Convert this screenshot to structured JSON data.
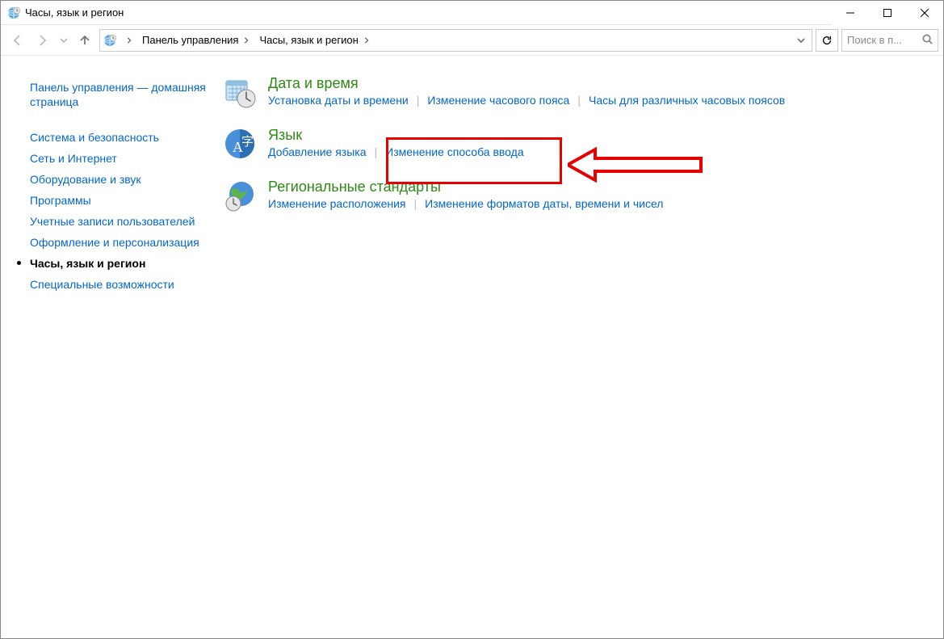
{
  "window": {
    "title": "Часы, язык и регион"
  },
  "breadcrumbs": {
    "root": "Панель управления",
    "current": "Часы, язык и регион"
  },
  "search": {
    "placeholder": "Поиск в п..."
  },
  "sidebar": {
    "home": "Панель управления — домашняя страница",
    "items": [
      "Система и безопасность",
      "Сеть и Интернет",
      "Оборудование и звук",
      "Программы",
      "Учетные записи пользователей",
      "Оформление и персонализация",
      "Часы, язык и регион",
      "Специальные возможности"
    ],
    "current_index": 6
  },
  "categories": [
    {
      "title": "Дата и время",
      "links": [
        "Установка даты и времени",
        "Изменение часового пояса",
        "Часы для различных часовых поясов"
      ]
    },
    {
      "title": "Язык",
      "links": [
        "Добавление языка",
        "Изменение способа ввода"
      ]
    },
    {
      "title": "Региональные стандарты",
      "links": [
        "Изменение расположения",
        "Изменение форматов даты, времени и чисел"
      ]
    }
  ]
}
